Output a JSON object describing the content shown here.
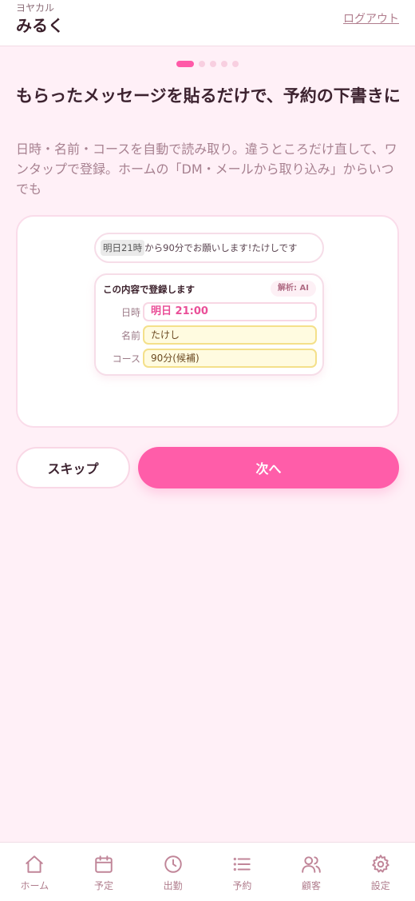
{
  "header": {
    "app_sub": "ヨヤカル",
    "app_title": "みるく",
    "logout_label": "ログアウト"
  },
  "pager": {
    "total": 5,
    "current": 1
  },
  "onboarding": {
    "headline": "もらったメッセージを貼るだけで、予約の下書きに",
    "description": "日時・名前・コースを自動で読み取り。違うところだけ直して、ワンタップで登録。ホームの「DM・メールから取り込み」からいつでも"
  },
  "preview": {
    "message_highlight": "明日21時",
    "message_rest": "から90分でお願いします!たけしです",
    "confirm_title": "この内容で登録します",
    "ai_badge": "解析: AI",
    "fields": [
      {
        "label": "日時",
        "value": "明日 21:00"
      },
      {
        "label": "名前",
        "value": "たけし"
      },
      {
        "label": "コース",
        "value": "90分(候補)"
      }
    ]
  },
  "actions": {
    "skip_label": "スキップ",
    "next_label": "次へ"
  },
  "nav": {
    "items": [
      {
        "label": "ホーム",
        "icon": "home-icon"
      },
      {
        "label": "予定",
        "icon": "calendar-icon"
      },
      {
        "label": "出勤",
        "icon": "clock-icon"
      },
      {
        "label": "予約",
        "icon": "list-icon"
      },
      {
        "label": "顧客",
        "icon": "users-icon"
      },
      {
        "label": "設定",
        "icon": "gear-icon"
      }
    ]
  },
  "colors": {
    "accent": "#ff5da9",
    "background": "#fff0f7",
    "highlight_field": "#fffbe0"
  }
}
